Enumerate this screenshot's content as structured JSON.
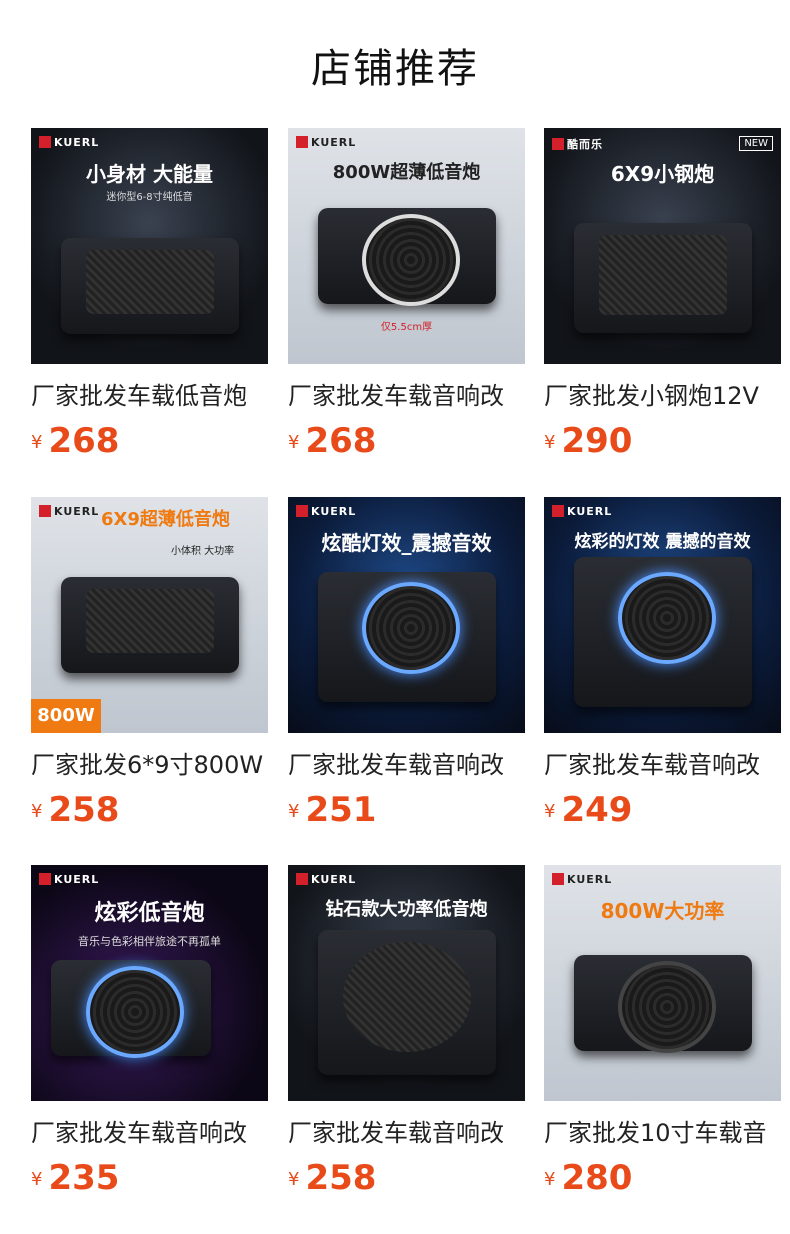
{
  "section_title": "店铺推荐",
  "currency_symbol": "¥",
  "products": [
    {
      "name": "厂家批发车载低音炮",
      "price": "268",
      "logo": "KUERL",
      "headline": "小身材 大能量",
      "sub": "迷你型6-8寸纯低音",
      "theme": "dark",
      "icon": "speaker-box"
    },
    {
      "name": "厂家批发车载音响改",
      "price": "268",
      "logo": "KUERL",
      "headline": "800W超薄低音炮",
      "sub": "仅5.5cm厚",
      "theme": "light",
      "icon": "speaker-ring"
    },
    {
      "name": "厂家批发小钢炮12V",
      "price": "290",
      "logo": "酷而乐",
      "headline": "6X9小钢炮",
      "sub": "",
      "theme": "dark",
      "icon": "speaker-box"
    },
    {
      "name": "厂家批发6*9寸800W",
      "price": "258",
      "logo": "KUERL",
      "headline": "6X9超薄低音炮",
      "sub": "小体积 大功率",
      "theme": "light",
      "icon": "speaker-box"
    },
    {
      "name": "厂家批发车载音响改",
      "price": "251",
      "logo": "KUERL",
      "headline": "炫酷灯效_震撼音效",
      "sub": "",
      "theme": "blue",
      "icon": "speaker-ring"
    },
    {
      "name": "厂家批发车载音响改",
      "price": "249",
      "logo": "KUERL",
      "headline": "炫彩的灯效 震撼的音效",
      "sub": "",
      "theme": "blue",
      "icon": "speaker-ring"
    },
    {
      "name": "厂家批发车载音响改",
      "price": "235",
      "logo": "KUERL",
      "headline": "炫彩低音炮",
      "sub": "音乐与色彩相伴旅途不再孤单",
      "theme": "purple",
      "icon": "speaker-ring"
    },
    {
      "name": "厂家批发车载音响改",
      "price": "258",
      "logo": "KUERL",
      "headline": "钻石款大功率低音炮",
      "sub": "",
      "theme": "dark",
      "icon": "speaker-box"
    },
    {
      "name": "厂家批发10寸车载音",
      "price": "280",
      "logo": "KUERL",
      "headline": "800W大功率",
      "sub": "",
      "theme": "light",
      "icon": "speaker-ring"
    }
  ],
  "badges": {
    "new": "NEW",
    "power": "800W"
  }
}
